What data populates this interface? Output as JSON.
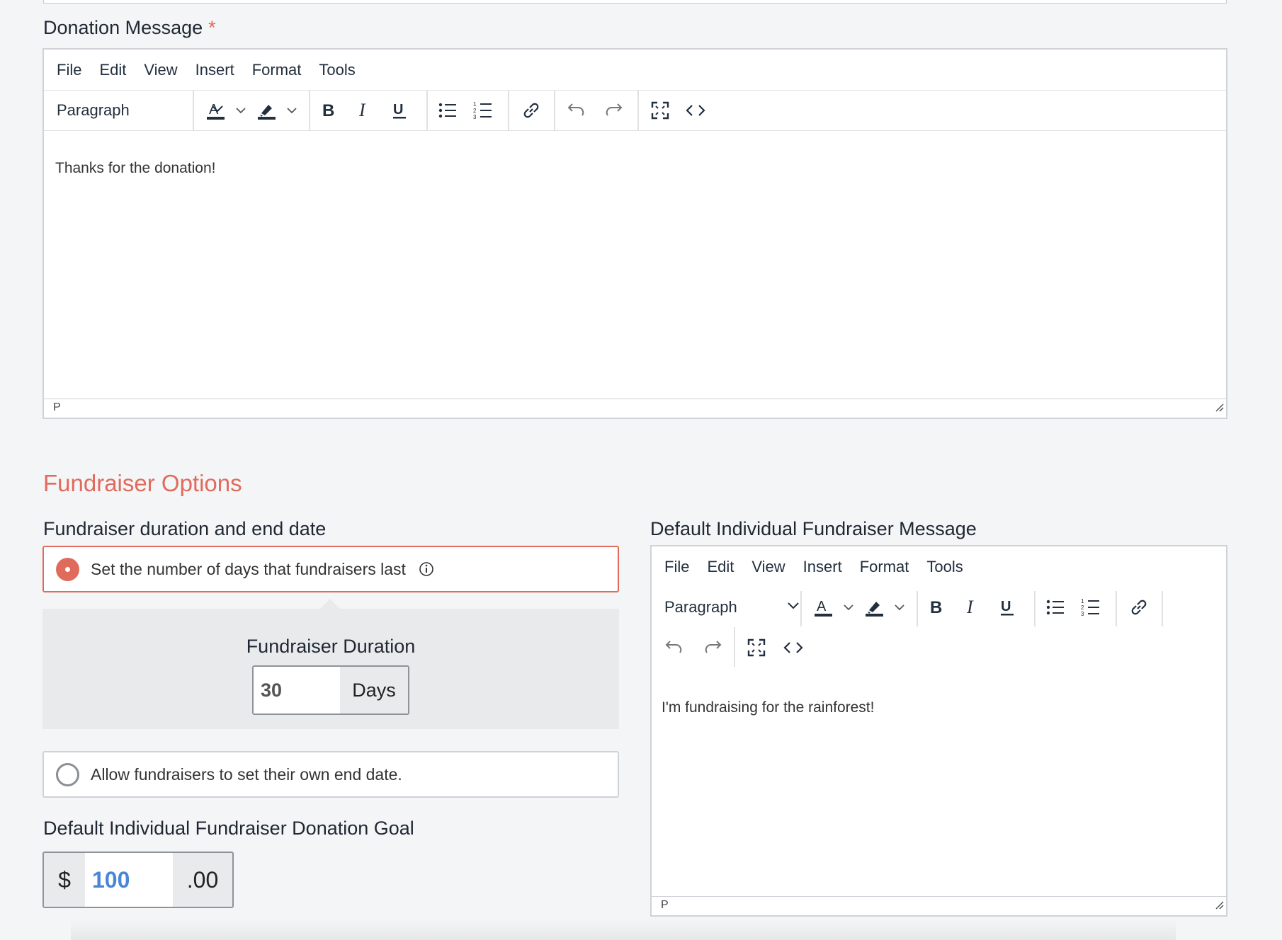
{
  "donation_message": {
    "label": "Donation Message",
    "required_marker": "*",
    "menu": [
      "File",
      "Edit",
      "View",
      "Insert",
      "Format",
      "Tools"
    ],
    "block_format": "Paragraph",
    "content": "Thanks for the donation!",
    "status_path": "P"
  },
  "fundraiser_options": {
    "title": "Fundraiser Options",
    "duration_label": "Fundraiser duration and end date",
    "option_days": "Set the number of days that fundraisers last",
    "option_days_selected": true,
    "duration_panel_label": "Fundraiser Duration",
    "duration_value": "30",
    "duration_unit": "Days",
    "option_end_date": "Allow fundraisers to set their own end date.",
    "option_end_date_selected": false,
    "goal_label": "Default Individual Fundraiser Donation Goal",
    "goal_currency": "$",
    "goal_value": "100",
    "goal_cents": ".00"
  },
  "individual_message": {
    "label": "Default Individual Fundraiser Message",
    "menu": [
      "File",
      "Edit",
      "View",
      "Insert",
      "Format",
      "Tools"
    ],
    "block_format": "Paragraph",
    "content": "I'm fundraising for the rainforest!",
    "status_path": "P"
  },
  "colors": {
    "accent": "#e06b5c",
    "goal_value": "#4a86d8",
    "background": "#f4f5f7"
  }
}
